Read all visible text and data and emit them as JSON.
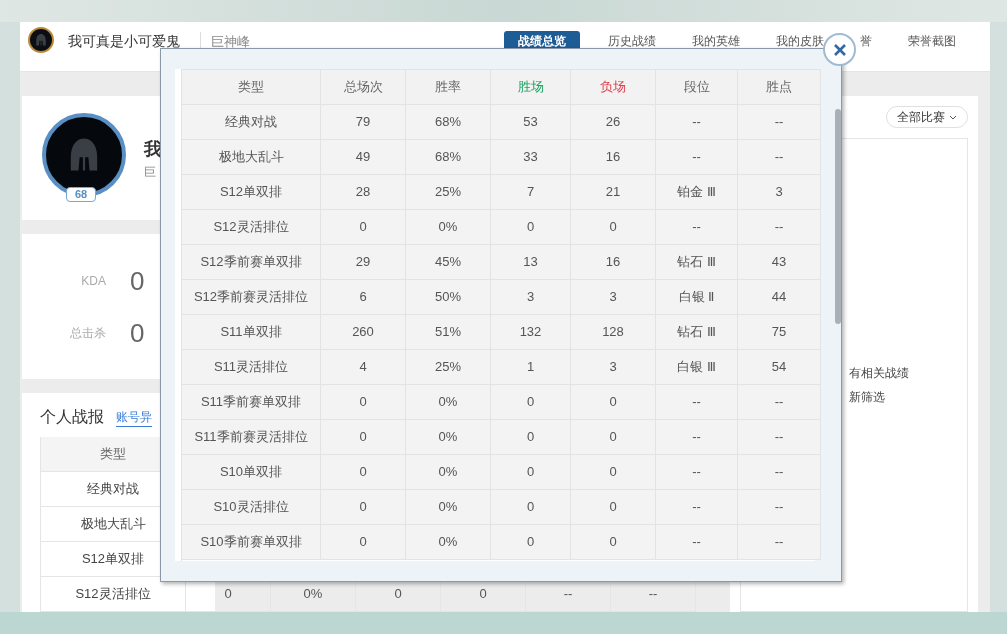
{
  "header": {
    "player_name": "我可真是小可爱鬼",
    "server": "巨神峰",
    "nav": [
      {
        "label": "战绩总览",
        "selected": true
      },
      {
        "label": "历史战绩",
        "selected": false
      },
      {
        "label": "我的英雄",
        "selected": false
      },
      {
        "label": "我的皮肤",
        "selected": false
      },
      {
        "label": "誉",
        "selected": false
      },
      {
        "label": "荣誉截图",
        "selected": false
      }
    ]
  },
  "profile": {
    "level": "68",
    "name": "我",
    "server": "巨"
  },
  "stats": [
    {
      "label": "KDA",
      "value": "0"
    },
    {
      "label": "总击杀",
      "value": "0"
    }
  ],
  "personal_report": {
    "title": "个人战报",
    "link": "账号异",
    "columns": [
      "类型"
    ],
    "rows": [
      {
        "type": "经典对战"
      },
      {
        "type": "极地大乱斗"
      },
      {
        "type": "S12单双排"
      },
      {
        "type": "S12灵活排位",
        "cells": [
          "0",
          "0%",
          "0",
          "0",
          "--",
          "--"
        ]
      }
    ]
  },
  "right_panel": {
    "filter": "全部比赛",
    "empty_lines": [
      "有相关战绩",
      "新筛选"
    ]
  },
  "modal": {
    "columns": [
      {
        "label": "类型",
        "kind": "plain"
      },
      {
        "label": "总场次",
        "kind": "plain"
      },
      {
        "label": "胜率",
        "kind": "plain"
      },
      {
        "label": "胜场",
        "kind": "wins"
      },
      {
        "label": "负场",
        "kind": "losses"
      },
      {
        "label": "段位",
        "kind": "plain"
      },
      {
        "label": "胜点",
        "kind": "plain"
      }
    ],
    "rows": [
      [
        "经典对战",
        "79",
        "68%",
        "53",
        "26",
        "--",
        "--"
      ],
      [
        "极地大乱斗",
        "49",
        "68%",
        "33",
        "16",
        "--",
        "--"
      ],
      [
        "S12单双排",
        "28",
        "25%",
        "7",
        "21",
        "铂金 Ⅲ",
        "3"
      ],
      [
        "S12灵活排位",
        "0",
        "0%",
        "0",
        "0",
        "--",
        "--"
      ],
      [
        "S12季前赛单双排",
        "29",
        "45%",
        "13",
        "16",
        "钻石 Ⅲ",
        "43"
      ],
      [
        "S12季前赛灵活排位",
        "6",
        "50%",
        "3",
        "3",
        "白银 Ⅱ",
        "44"
      ],
      [
        "S11单双排",
        "260",
        "51%",
        "132",
        "128",
        "钻石 Ⅲ",
        "75"
      ],
      [
        "S11灵活排位",
        "4",
        "25%",
        "1",
        "3",
        "白银 Ⅲ",
        "54"
      ],
      [
        "S11季前赛单双排",
        "0",
        "0%",
        "0",
        "0",
        "--",
        "--"
      ],
      [
        "S11季前赛灵活排位",
        "0",
        "0%",
        "0",
        "0",
        "--",
        "--"
      ],
      [
        "S10单双排",
        "0",
        "0%",
        "0",
        "0",
        "--",
        "--"
      ],
      [
        "S10灵活排位",
        "0",
        "0%",
        "0",
        "0",
        "--",
        "--"
      ],
      [
        "S10季前赛单双排",
        "0",
        "0%",
        "0",
        "0",
        "--",
        "--"
      ]
    ]
  }
}
